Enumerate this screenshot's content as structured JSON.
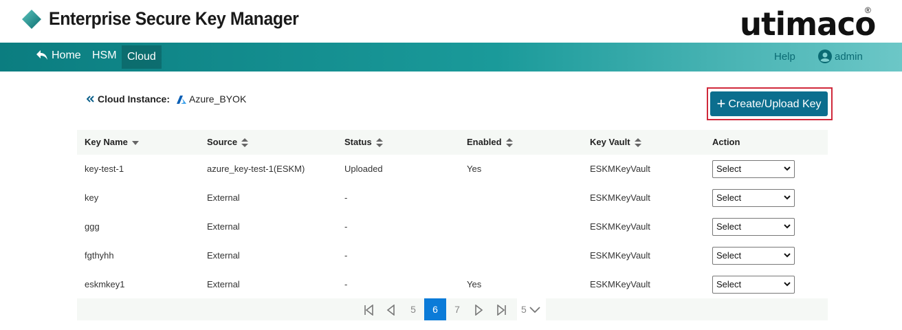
{
  "app": {
    "title": "Enterprise Secure Key Manager",
    "brand": "utimaco",
    "brand_mark": "®",
    "colors": {
      "accent": "#0b6e8e",
      "nav": "#1a9a9a",
      "highlight": "#d0283a"
    }
  },
  "nav": {
    "home": "Home",
    "hsm": "HSM",
    "cloud": "Cloud",
    "help": "Help",
    "user": "admin"
  },
  "breadcrumb": {
    "label": "Cloud Instance:",
    "value": "Azure_BYOK"
  },
  "actions": {
    "create_label": "Create/Upload Key"
  },
  "table": {
    "headers": [
      "Key Name",
      "Source",
      "Status",
      "Enabled",
      "Key Vault",
      "Action"
    ],
    "rows": [
      {
        "name": "key-test-1",
        "source": "azure_key-test-1(ESKM)",
        "status": "Uploaded",
        "enabled": "Yes",
        "vault": "ESKMKeyVault",
        "action": "Select"
      },
      {
        "name": "key",
        "source": "External",
        "status": "-",
        "enabled": "",
        "vault": "ESKMKeyVault",
        "action": "Select"
      },
      {
        "name": "ggg",
        "source": "External",
        "status": "-",
        "enabled": "",
        "vault": "ESKMKeyVault",
        "action": "Select"
      },
      {
        "name": "fgthyhh",
        "source": "External",
        "status": "-",
        "enabled": "",
        "vault": "ESKMKeyVault",
        "action": "Select"
      },
      {
        "name": "eskmkey1",
        "source": "External",
        "status": "-",
        "enabled": "Yes",
        "vault": "ESKMKeyVault",
        "action": "Select"
      }
    ]
  },
  "pagination": {
    "prev_page": "5",
    "current_page": "6",
    "next_page": "7",
    "page_size": "5"
  }
}
